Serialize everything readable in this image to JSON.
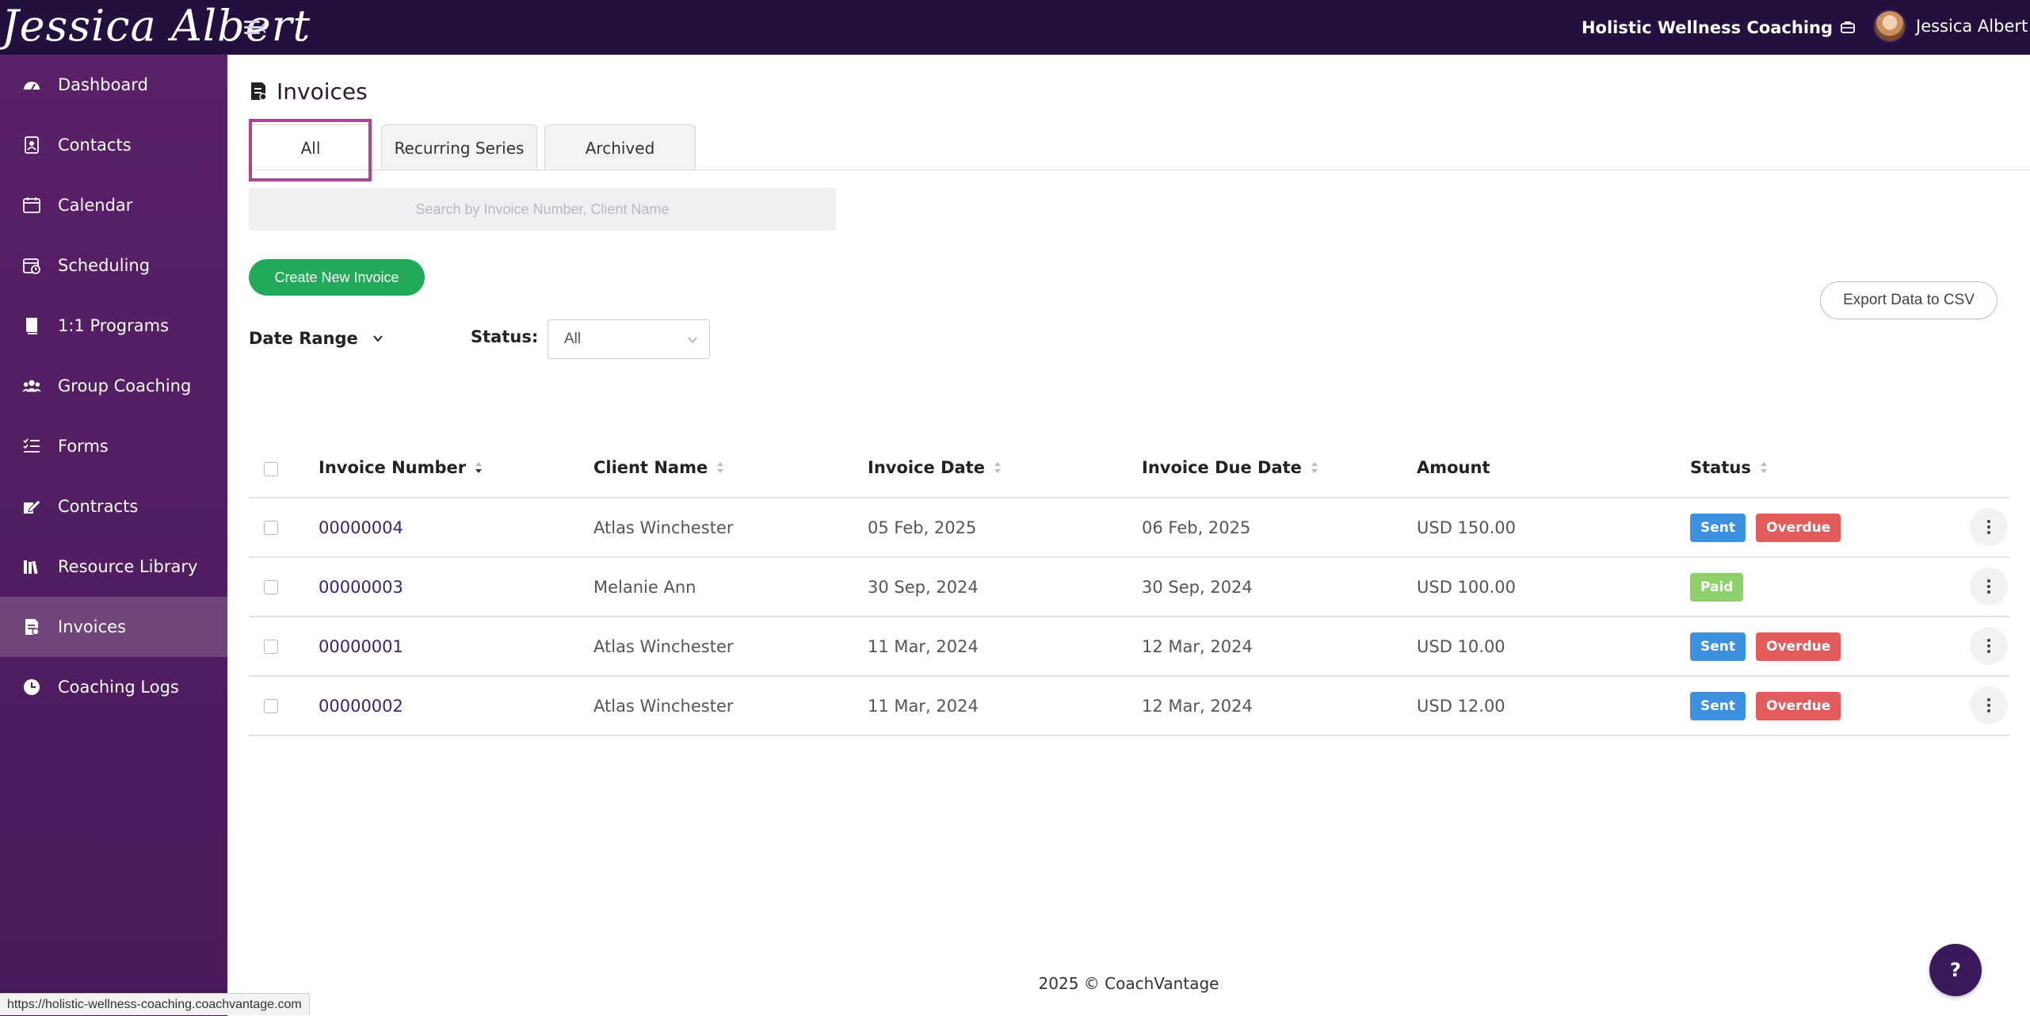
{
  "brand": {
    "name": "Jessica Albert"
  },
  "header": {
    "organization": "Holistic Wellness Coaching",
    "username": "Jessica Albert"
  },
  "sidebar": {
    "items": [
      {
        "label": "Dashboard",
        "icon": "dashboard-icon"
      },
      {
        "label": "Contacts",
        "icon": "contacts-icon"
      },
      {
        "label": "Calendar",
        "icon": "calendar-icon"
      },
      {
        "label": "Scheduling",
        "icon": "scheduling-icon"
      },
      {
        "label": "1:1 Programs",
        "icon": "book-icon"
      },
      {
        "label": "Group Coaching",
        "icon": "group-icon"
      },
      {
        "label": "Forms",
        "icon": "forms-icon"
      },
      {
        "label": "Contracts",
        "icon": "contract-icon"
      },
      {
        "label": "Resource Library",
        "icon": "library-icon"
      },
      {
        "label": "Invoices",
        "icon": "invoice-icon",
        "active": true
      },
      {
        "label": "Coaching Logs",
        "icon": "clock-icon"
      }
    ]
  },
  "page": {
    "title": "Invoices",
    "tabs": [
      {
        "label": "All",
        "active": true
      },
      {
        "label": "Recurring Series"
      },
      {
        "label": "Archived"
      }
    ],
    "search_placeholder": "Search by Invoice Number, Client Name",
    "create_button": "Create New Invoice",
    "export_button": "Export Data to CSV",
    "date_range_label": "Date Range",
    "status_label": "Status:",
    "status_value": "All"
  },
  "table": {
    "columns": [
      "Invoice Number",
      "Client Name",
      "Invoice Date",
      "Invoice Due Date",
      "Amount",
      "Status"
    ],
    "rows": [
      {
        "invoice_number": "00000004",
        "client": "Atlas Winchester",
        "date": "05 Feb, 2025",
        "due": "06 Feb, 2025",
        "amount": "USD 150.00",
        "statuses": [
          "Sent",
          "Overdue"
        ]
      },
      {
        "invoice_number": "00000003",
        "client": "Melanie Ann",
        "date": "30 Sep, 2024",
        "due": "30 Sep, 2024",
        "amount": "USD 100.00",
        "statuses": [
          "Paid"
        ]
      },
      {
        "invoice_number": "00000001",
        "client": "Atlas Winchester",
        "date": "11 Mar, 2024",
        "due": "12 Mar, 2024",
        "amount": "USD 10.00",
        "statuses": [
          "Sent",
          "Overdue"
        ]
      },
      {
        "invoice_number": "00000002",
        "client": "Atlas Winchester",
        "date": "11 Mar, 2024",
        "due": "12 Mar, 2024",
        "amount": "USD 12.00",
        "statuses": [
          "Sent",
          "Overdue"
        ]
      }
    ]
  },
  "status_colors": {
    "Sent": "#3d8fdf",
    "Overdue": "#e25c5c",
    "Paid": "#8ed06a"
  },
  "colors": {
    "topbar": "#24103f",
    "sidebar": "#4f1d60",
    "accent_green": "#22a95a",
    "tab_highlight": "#a8478f"
  },
  "footer": {
    "text": "2025 © CoachVantage"
  },
  "help_button": "?",
  "statusbar_url": "https://holistic-wellness-coaching.coachvantage.com"
}
